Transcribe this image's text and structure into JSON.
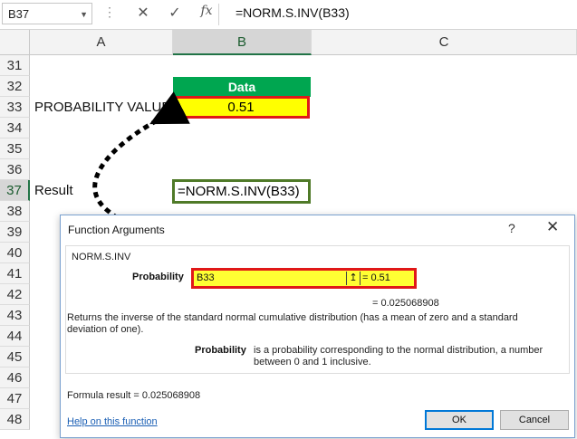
{
  "formula_bar": {
    "name_box": "B37",
    "cancel_icon": "✕",
    "enter_icon": "✓",
    "fx_label": "fx",
    "formula": "=NORM.S.INV(B33)"
  },
  "columns": [
    "A",
    "B",
    "C"
  ],
  "selected_column": "B",
  "rows": [
    "31",
    "32",
    "33",
    "34",
    "35",
    "36",
    "37",
    "38",
    "39",
    "40",
    "41",
    "42",
    "43",
    "44",
    "45",
    "46",
    "47",
    "48"
  ],
  "selected_row": "37",
  "cells": {
    "a33": "PROBABILITY VALUE",
    "a37": "Result",
    "b32_header": "Data",
    "b33_value": "0.51",
    "b37_formula": "=NORM.S.INV(B33)"
  },
  "dialog": {
    "title": "Function Arguments",
    "help_icon": "?",
    "close_icon": "✕",
    "function_name": "NORM.S.INV",
    "arg_label": "Probability",
    "arg_value": "B33",
    "collapse_icon": "↥",
    "arg_result": "=  0.51",
    "result_value": "=  0.025068908",
    "description": "Returns the inverse of the standard normal cumulative distribution (has a mean of zero and a standard deviation of one).",
    "param_name": "Probability",
    "param_desc": "is a probability corresponding to the normal distribution, a number between 0 and 1 inclusive.",
    "formula_result": "Formula result =   0.025068908",
    "help_link": "Help on this function",
    "ok_label": "OK",
    "cancel_label": "Cancel"
  },
  "colors": {
    "header_green": "#00a650",
    "highlight_yellow": "#ffff00",
    "border_red": "#e01818",
    "result_border_green": "#4f7a28",
    "arrow_black": "#000000"
  }
}
